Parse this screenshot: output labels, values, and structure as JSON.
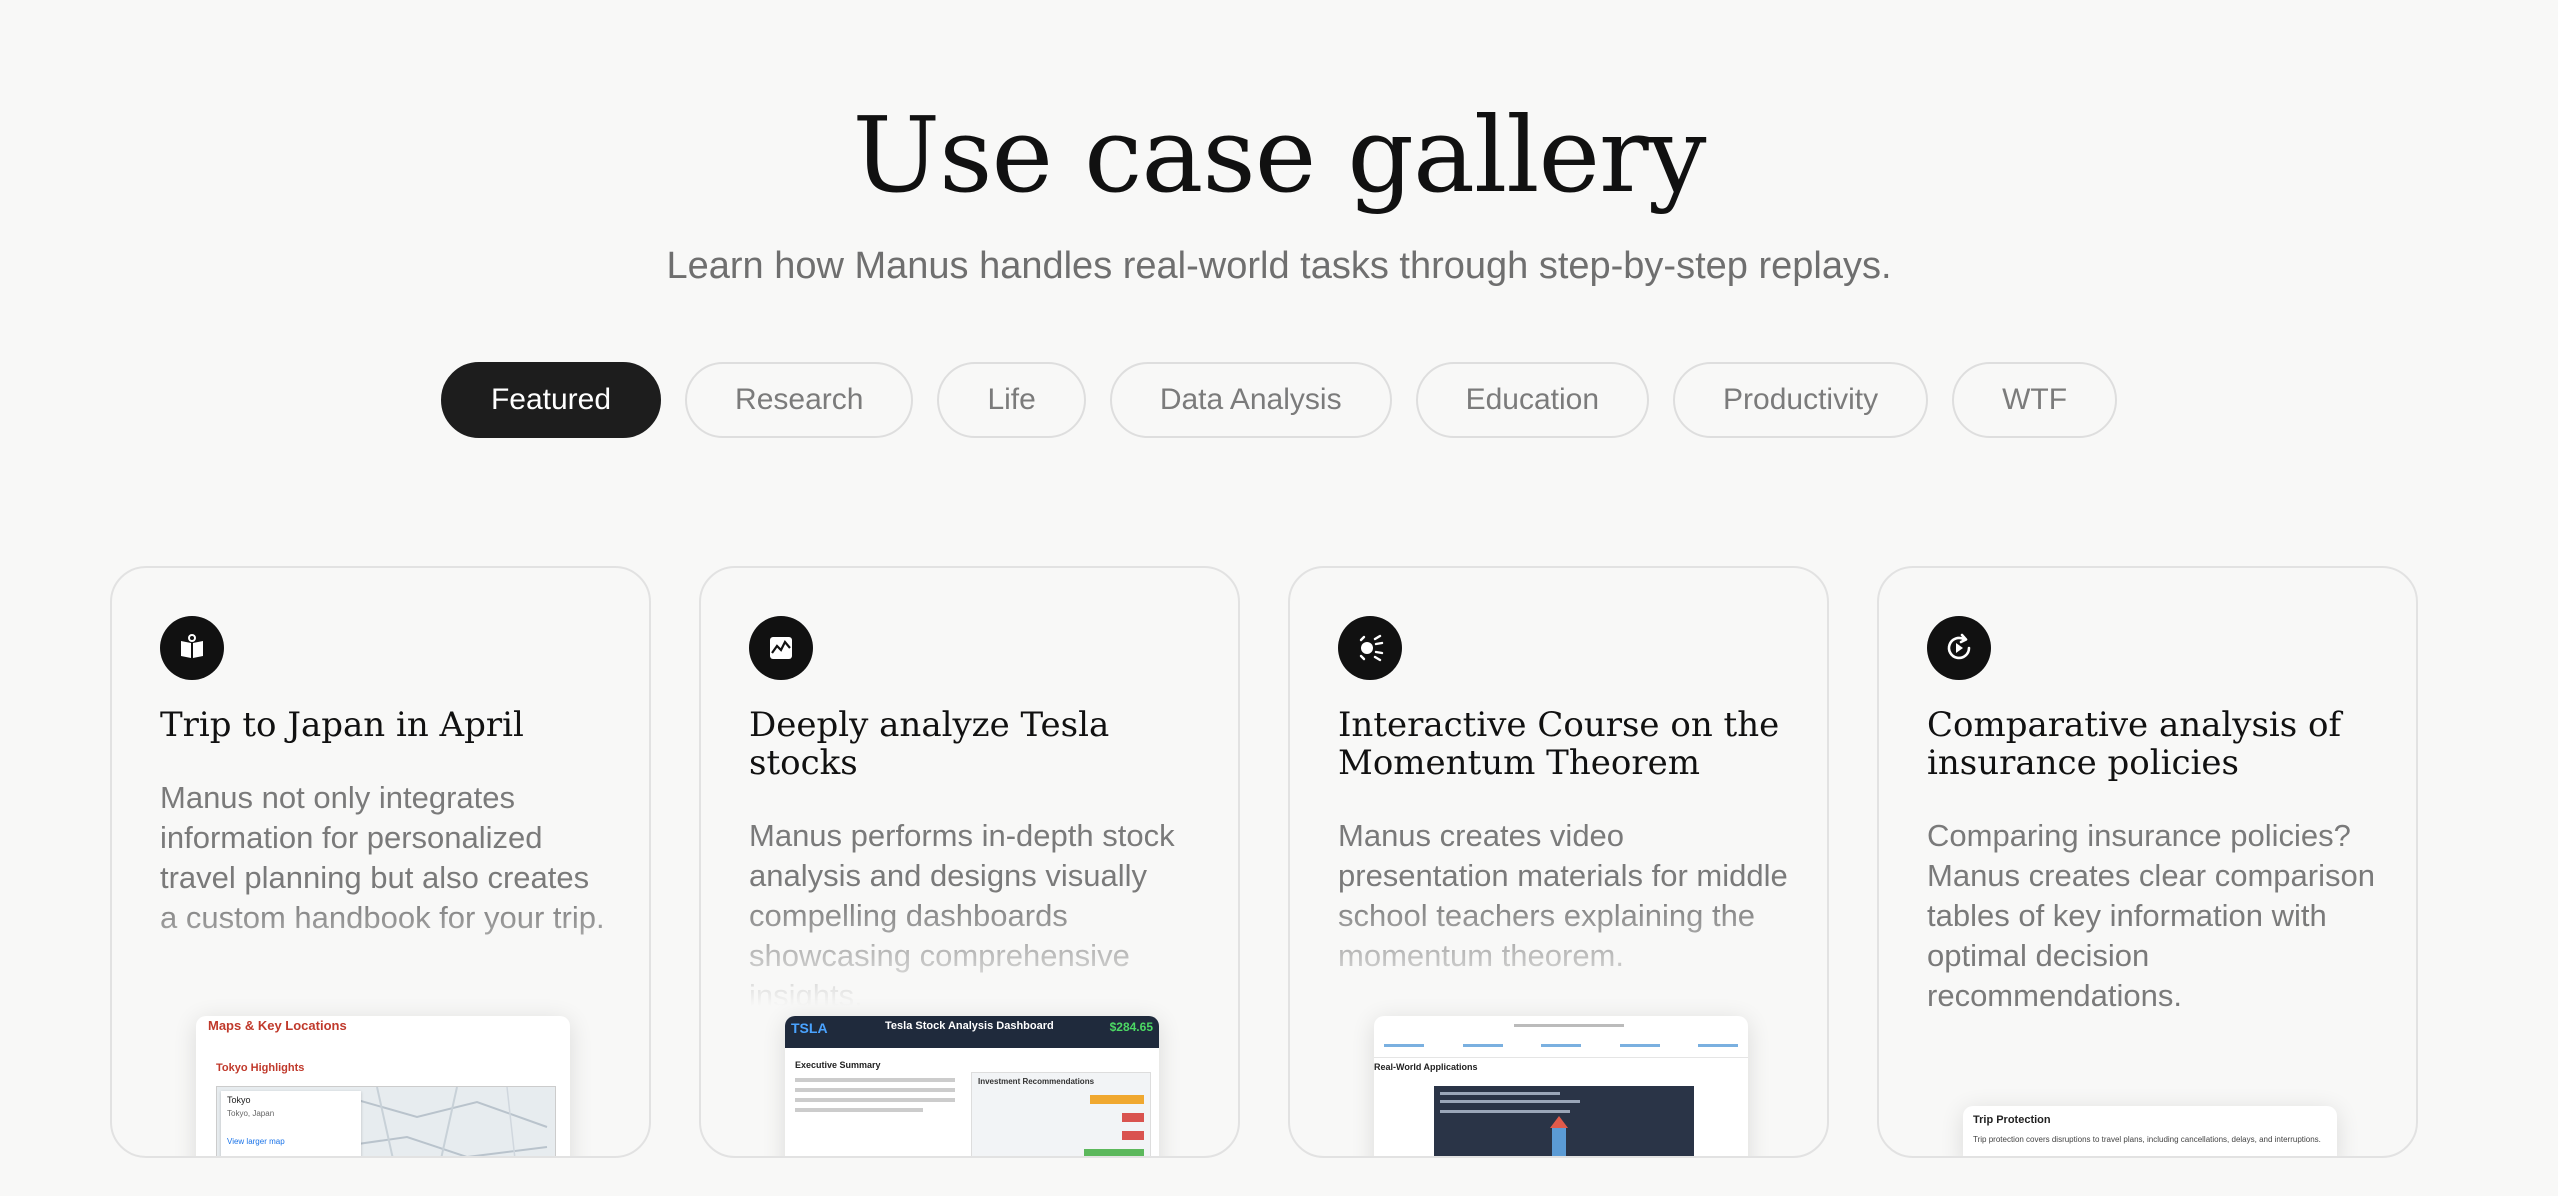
{
  "hero": {
    "title": "Use case gallery",
    "subtitle": "Learn how Manus handles real-world tasks through step-by-step replays."
  },
  "tabs": [
    {
      "label": "Featured",
      "active": true
    },
    {
      "label": "Research"
    },
    {
      "label": "Life"
    },
    {
      "label": "Data Analysis"
    },
    {
      "label": "Education"
    },
    {
      "label": "Productivity"
    },
    {
      "label": "WTF"
    }
  ],
  "cards": [
    {
      "icon": "book-icon",
      "title": "Trip to Japan in April",
      "description": "Manus not only integrates information for personalized travel planning but also creates a custom handbook for your trip.",
      "preview": {
        "heading": "Maps & Key Locations",
        "subheading": "Tokyo Highlights",
        "place": "Tokyo",
        "place_sub": "Tokyo, Japan",
        "link": "View larger map"
      }
    },
    {
      "icon": "chart-icon",
      "title": "Deeply analyze Tesla stocks",
      "description": "Manus performs in-depth stock analysis and designs visually compelling dashboards showcasing comprehensive insights.",
      "preview": {
        "ticker": "TSLA",
        "title": "Tesla Stock Analysis Dashboard",
        "price": "$284.65",
        "section": "Executive Summary",
        "reco_title": "Investment Recommendations"
      }
    },
    {
      "icon": "spark-icon",
      "title": "Interactive Course on the Momentum Theorem",
      "description": "Manus creates video presentation materials for middle school teachers explaining the momentum theorem.",
      "preview": {
        "section": "Real-World Applications"
      }
    },
    {
      "icon": "replay-icon",
      "title": "Comparative analysis of insurance policies",
      "description": "Comparing insurance policies? Manus creates clear comparison tables of key information with optimal decision recommendations.",
      "preview": {
        "heading": "Trip Protection",
        "body": "Trip protection covers disruptions to travel plans, including cancellations, delays, and interruptions."
      }
    }
  ]
}
